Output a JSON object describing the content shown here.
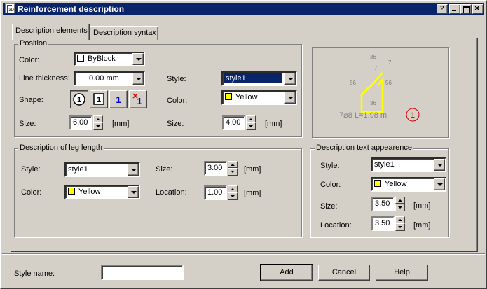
{
  "window": {
    "title": "Reinforcement description",
    "buttons": [
      "?",
      "minimize",
      "maximize",
      "close"
    ],
    "help_label": "?"
  },
  "tabs": [
    {
      "label": "Description elements",
      "active": true
    },
    {
      "label": "Description syntax",
      "active": false
    }
  ],
  "position": {
    "group_label": "Position",
    "color_label": "Color:",
    "color_value": "ByBlock",
    "color_swatch": "#ffffff",
    "line_thickness_label": "Line thickness:",
    "line_thickness_value": "0.00 mm",
    "shape_label": "Shape:",
    "shapes": [
      "1",
      "1",
      "1",
      "1"
    ],
    "size_label": "Size:",
    "size_value": "6.00",
    "size_unit": "[mm]",
    "style_label": "Style:",
    "style_value": "style1",
    "right_color_label": "Color:",
    "right_color_value": "Yellow",
    "right_color_swatch": "#ffff00",
    "right_size_label": "Size:",
    "right_size_value": "4.00",
    "right_size_unit": "[mm]"
  },
  "preview": {
    "dims": [
      "36",
      "7",
      "7",
      "56",
      "56",
      "36"
    ],
    "caption": "7⌀8  L=1.98 m",
    "marker": "1"
  },
  "leg_length": {
    "group_label": "Description of leg length",
    "style_label": "Style:",
    "style_value": "style1",
    "color_label": "Color:",
    "color_value": "Yellow",
    "color_swatch": "#ffff00",
    "size_label": "Size:",
    "size_value": "3.00",
    "size_unit": "[mm]",
    "location_label": "Location:",
    "location_value": "1.00",
    "location_unit": "[mm]"
  },
  "text_appearance": {
    "group_label": "Description text appearence",
    "style_label": "Style:",
    "style_value": "style1",
    "color_label": "Color:",
    "color_value": "Yellow",
    "color_swatch": "#ffff00",
    "size_label": "Size:",
    "size_value": "3.50",
    "size_unit": "[mm]",
    "location_label": "Location:",
    "location_value": "3.50",
    "location_unit": "[mm]"
  },
  "footer": {
    "style_name_label": "Style name:",
    "style_name_value": "",
    "add_label": "Add",
    "cancel_label": "Cancel",
    "help_label": "Help"
  }
}
